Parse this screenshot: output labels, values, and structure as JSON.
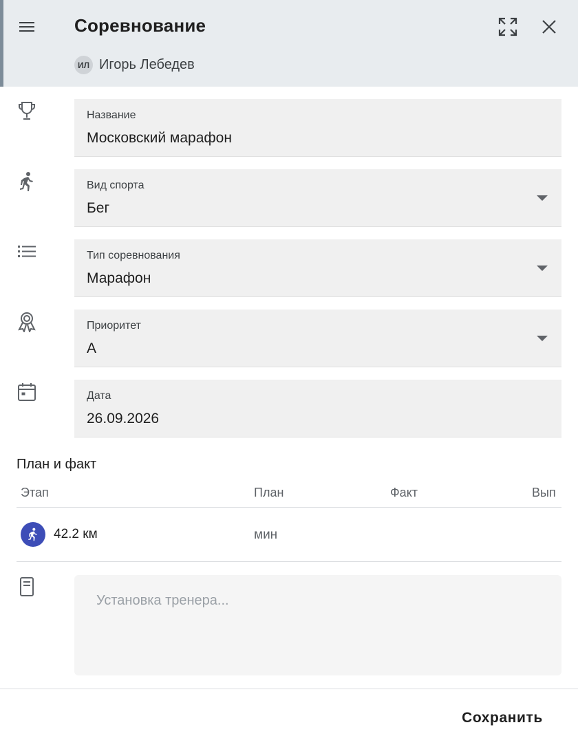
{
  "dialog": {
    "title": "Соревнование",
    "user": {
      "initials": "ИЛ",
      "name": "Игорь Лебедев"
    },
    "icons": {
      "menu": "menu-icon",
      "expand": "expand-icon",
      "close": "close-icon"
    }
  },
  "fields": {
    "name": {
      "label": "Название",
      "value": "Московский марафон",
      "icon": "trophy-icon"
    },
    "sport": {
      "label": "Вид спорта",
      "value": "Бег",
      "icon": "running-icon"
    },
    "type": {
      "label": "Тип соревнования",
      "value": "Марафон",
      "icon": "list-icon"
    },
    "priority": {
      "label": "Приоритет",
      "value": "A",
      "icon": "award-icon"
    },
    "date": {
      "label": "Дата",
      "value": "26.09.2026",
      "icon": "calendar-icon"
    }
  },
  "plan": {
    "title": "План и факт",
    "columns": {
      "stage": "Этап",
      "plan": "План",
      "fact": "Факт",
      "done": "Вып"
    },
    "rows": [
      {
        "stage": "42.2 км",
        "plan": "мин",
        "icon": "running-icon"
      }
    ]
  },
  "notes": {
    "placeholder": "Установка тренера...",
    "icon": "note-icon"
  },
  "footer": {
    "save_label": "Сохранить"
  },
  "colors": {
    "header_bg": "#e8ecef",
    "field_bg": "#f0f0f0",
    "stage_icon_bg": "#3d4db7"
  }
}
